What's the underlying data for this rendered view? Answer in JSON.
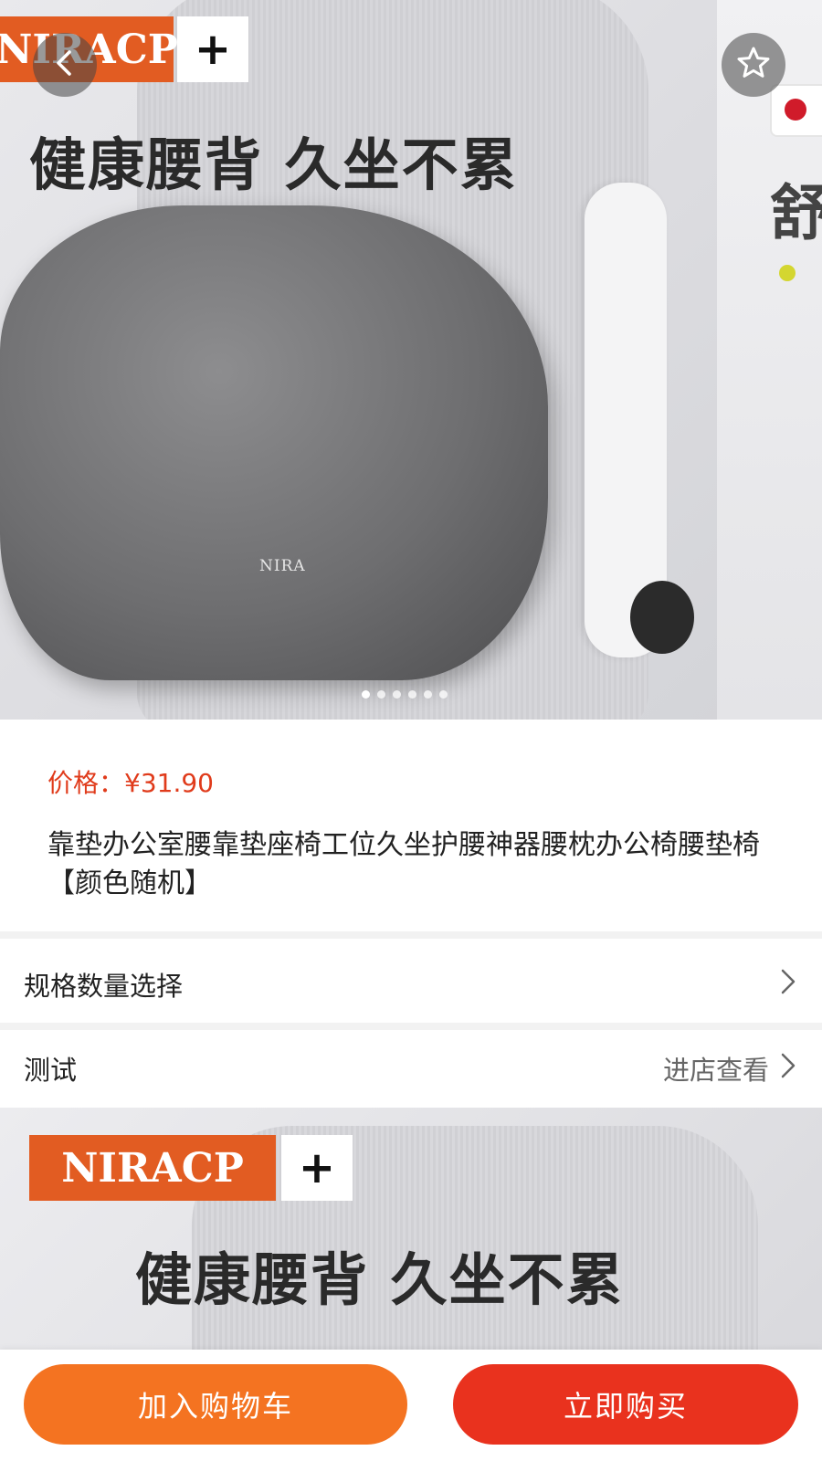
{
  "hero": {
    "brand_name": "NIRACP",
    "brand_plus": "+",
    "headline": "健康腰背 久坐不累",
    "cushion_brand": "NIRA",
    "side_char": "舒",
    "carousel_dots": 6,
    "active_dot": 0
  },
  "product": {
    "price_label": "价格：",
    "price_value": "¥31.90",
    "title": "靠垫办公室腰靠垫座椅工位久坐护腰神器腰枕办公椅腰垫椅 【颜色随机】"
  },
  "spec_row": {
    "label": "规格数量选择"
  },
  "shop_row": {
    "label": "测试",
    "action": "进店查看"
  },
  "detail": {
    "brand_name": "NIRACP",
    "brand_plus": "+",
    "headline": "健康腰背 久坐不累"
  },
  "actions": {
    "add_to_cart": "加入购物车",
    "buy_now": "立即购买"
  },
  "colors": {
    "price": "#e03b1b",
    "cart_button": "#f47321",
    "buy_button": "#e9321e",
    "brand_orange": "#e25c22"
  },
  "icons": {
    "back": "chevron-left-icon",
    "favorite": "star-outline-icon",
    "row_arrow": "chevron-right-icon"
  }
}
